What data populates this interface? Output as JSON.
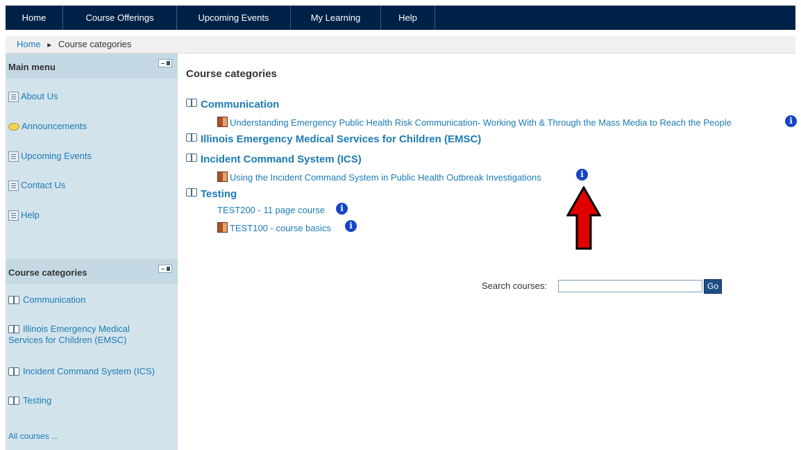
{
  "nav": {
    "items": [
      {
        "label": "Home"
      },
      {
        "label": "Course Offerings"
      },
      {
        "label": "Upcoming Events"
      },
      {
        "label": "My Learning"
      },
      {
        "label": "Help"
      }
    ]
  },
  "breadcrumb": {
    "home": "Home",
    "separator": "►",
    "current": "Course categories"
  },
  "sidebar": {
    "main_menu": {
      "title": "Main menu",
      "items": [
        {
          "label": "About Us",
          "icon": "page-icon"
        },
        {
          "label": "Announcements",
          "icon": "speech-bubble-icon"
        },
        {
          "label": "Upcoming Events",
          "icon": "page-icon"
        },
        {
          "label": "Contact Us",
          "icon": "page-icon"
        },
        {
          "label": "Help",
          "icon": "page-icon"
        }
      ]
    },
    "categories_block": {
      "title": "Course categories",
      "items": [
        {
          "label": "Communication"
        },
        {
          "label": "Illinois Emergency Medical Services for Children (EMSC)"
        },
        {
          "label": "Incident Command System (ICS)"
        },
        {
          "label": "Testing"
        }
      ],
      "all_courses": "All courses ..."
    }
  },
  "main": {
    "title": "Course categories",
    "categories": [
      {
        "name": "Communication",
        "courses": [
          {
            "name": "Understanding Emergency Public Health Risk Communication- Working With & Through the Mass Media to Reach the People",
            "icon": "door-icon",
            "info": "i"
          }
        ]
      },
      {
        "name": "Illinois Emergency Medical Services for Children (EMSC)",
        "courses": []
      },
      {
        "name": "Incident Command System (ICS)",
        "courses": [
          {
            "name": "Using the Incident Command System in Public Health Outbreak Investigations",
            "icon": "door-icon",
            "info": "i"
          }
        ]
      },
      {
        "name": "Testing",
        "courses": [
          {
            "name": "TEST200 - 11 page course",
            "icon": "",
            "info": "i"
          },
          {
            "name": "TEST100 - course basics",
            "icon": "door-icon",
            "info": "i"
          }
        ]
      }
    ]
  },
  "search": {
    "label": "Search courses:",
    "value": "",
    "button": "Go"
  },
  "colors": {
    "nav_bg": "#002147",
    "sidebar_bg": "#d3e3ec",
    "link": "#1b7bb5",
    "info_icon": "#1745c8",
    "annotation_arrow": "#e00000"
  }
}
